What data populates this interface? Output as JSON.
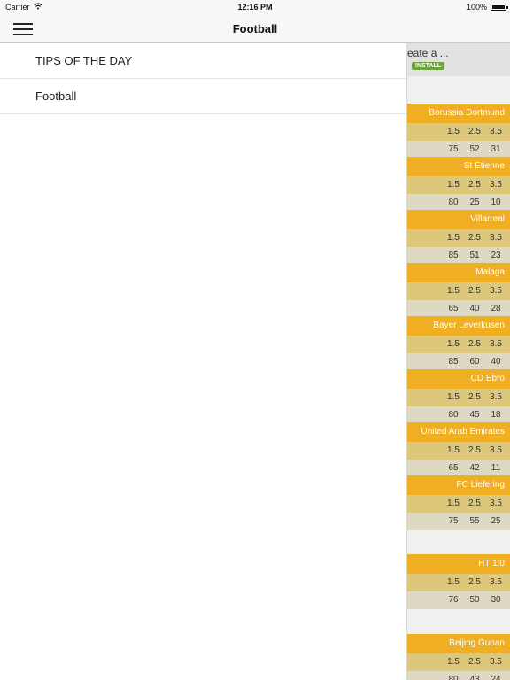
{
  "status": {
    "carrier": "Carrier",
    "time": "12:16 PM",
    "battery": "100%"
  },
  "navbar": {
    "title": "Football"
  },
  "drawer": {
    "items": [
      {
        "label": "TIPS OF THE DAY"
      },
      {
        "label": "Football"
      }
    ]
  },
  "ad": {
    "title": "eate a ...",
    "install": "INSTALL"
  },
  "teams": [
    {
      "name": "Borussia Dortmund",
      "lines": [
        "1.5",
        "2.5",
        "3.5"
      ],
      "pcts": [
        "75",
        "52",
        "31"
      ]
    },
    {
      "name": "St Etienne",
      "lines": [
        "1.5",
        "2.5",
        "3.5"
      ],
      "pcts": [
        "80",
        "25",
        "10"
      ]
    },
    {
      "name": "Villarreal",
      "lines": [
        "1.5",
        "2.5",
        "3.5"
      ],
      "pcts": [
        "85",
        "51",
        "23"
      ]
    },
    {
      "name": "Malaga",
      "lines": [
        "1.5",
        "2.5",
        "3.5"
      ],
      "pcts": [
        "65",
        "40",
        "28"
      ]
    },
    {
      "name": "Bayer Leverkusen",
      "lines": [
        "1.5",
        "2.5",
        "3.5"
      ],
      "pcts": [
        "85",
        "60",
        "40"
      ]
    },
    {
      "name": "CD Ebro",
      "lines": [
        "1.5",
        "2.5",
        "3.5"
      ],
      "pcts": [
        "80",
        "45",
        "18"
      ]
    },
    {
      "name": "United Arab Emirates",
      "lines": [
        "1.5",
        "2.5",
        "3.5"
      ],
      "pcts": [
        "65",
        "42",
        "11"
      ]
    },
    {
      "name": "FC Liefering",
      "lines": [
        "1.5",
        "2.5",
        "3.5"
      ],
      "pcts": [
        "75",
        "55",
        "25"
      ]
    },
    {
      "name": "HT 1:0",
      "lines": [
        "1.5",
        "2.5",
        "3.5"
      ],
      "pcts": [
        "76",
        "50",
        "30"
      ]
    },
    {
      "name": "Beijing Guoan",
      "lines": [
        "1.5",
        "2.5",
        "3.5"
      ],
      "pcts": [
        "80",
        "43",
        "24"
      ]
    }
  ],
  "colors": {
    "team_header": "#f0ae22",
    "lines_row": "#dcc77a",
    "pct_row": "#ddd9c3",
    "install_badge": "#6ea23f"
  }
}
